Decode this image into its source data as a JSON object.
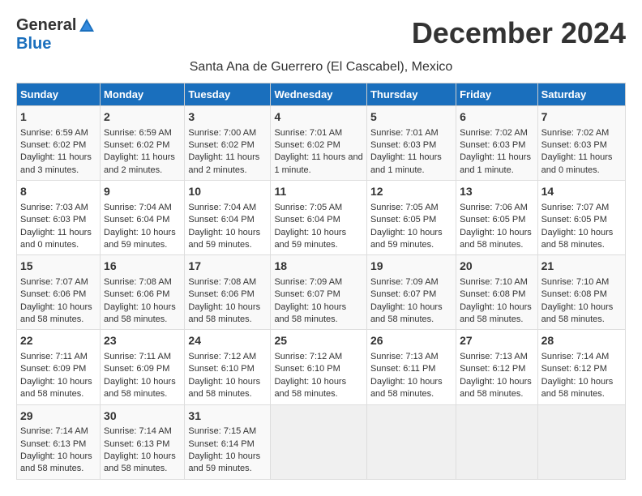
{
  "header": {
    "logo_general": "General",
    "logo_blue": "Blue",
    "month_title": "December 2024",
    "location": "Santa Ana de Guerrero (El Cascabel), Mexico"
  },
  "days_of_week": [
    "Sunday",
    "Monday",
    "Tuesday",
    "Wednesday",
    "Thursday",
    "Friday",
    "Saturday"
  ],
  "weeks": [
    [
      {
        "day": 1,
        "sunrise": "6:59 AM",
        "sunset": "6:02 PM",
        "daylight": "11 hours and 3 minutes."
      },
      {
        "day": 2,
        "sunrise": "6:59 AM",
        "sunset": "6:02 PM",
        "daylight": "11 hours and 2 minutes."
      },
      {
        "day": 3,
        "sunrise": "7:00 AM",
        "sunset": "6:02 PM",
        "daylight": "11 hours and 2 minutes."
      },
      {
        "day": 4,
        "sunrise": "7:01 AM",
        "sunset": "6:02 PM",
        "daylight": "11 hours and 1 minute."
      },
      {
        "day": 5,
        "sunrise": "7:01 AM",
        "sunset": "6:03 PM",
        "daylight": "11 hours and 1 minute."
      },
      {
        "day": 6,
        "sunrise": "7:02 AM",
        "sunset": "6:03 PM",
        "daylight": "11 hours and 1 minute."
      },
      {
        "day": 7,
        "sunrise": "7:02 AM",
        "sunset": "6:03 PM",
        "daylight": "11 hours and 0 minutes."
      }
    ],
    [
      {
        "day": 8,
        "sunrise": "7:03 AM",
        "sunset": "6:03 PM",
        "daylight": "11 hours and 0 minutes."
      },
      {
        "day": 9,
        "sunrise": "7:04 AM",
        "sunset": "6:04 PM",
        "daylight": "10 hours and 59 minutes."
      },
      {
        "day": 10,
        "sunrise": "7:04 AM",
        "sunset": "6:04 PM",
        "daylight": "10 hours and 59 minutes."
      },
      {
        "day": 11,
        "sunrise": "7:05 AM",
        "sunset": "6:04 PM",
        "daylight": "10 hours and 59 minutes."
      },
      {
        "day": 12,
        "sunrise": "7:05 AM",
        "sunset": "6:05 PM",
        "daylight": "10 hours and 59 minutes."
      },
      {
        "day": 13,
        "sunrise": "7:06 AM",
        "sunset": "6:05 PM",
        "daylight": "10 hours and 58 minutes."
      },
      {
        "day": 14,
        "sunrise": "7:07 AM",
        "sunset": "6:05 PM",
        "daylight": "10 hours and 58 minutes."
      }
    ],
    [
      {
        "day": 15,
        "sunrise": "7:07 AM",
        "sunset": "6:06 PM",
        "daylight": "10 hours and 58 minutes."
      },
      {
        "day": 16,
        "sunrise": "7:08 AM",
        "sunset": "6:06 PM",
        "daylight": "10 hours and 58 minutes."
      },
      {
        "day": 17,
        "sunrise": "7:08 AM",
        "sunset": "6:06 PM",
        "daylight": "10 hours and 58 minutes."
      },
      {
        "day": 18,
        "sunrise": "7:09 AM",
        "sunset": "6:07 PM",
        "daylight": "10 hours and 58 minutes."
      },
      {
        "day": 19,
        "sunrise": "7:09 AM",
        "sunset": "6:07 PM",
        "daylight": "10 hours and 58 minutes."
      },
      {
        "day": 20,
        "sunrise": "7:10 AM",
        "sunset": "6:08 PM",
        "daylight": "10 hours and 58 minutes."
      },
      {
        "day": 21,
        "sunrise": "7:10 AM",
        "sunset": "6:08 PM",
        "daylight": "10 hours and 58 minutes."
      }
    ],
    [
      {
        "day": 22,
        "sunrise": "7:11 AM",
        "sunset": "6:09 PM",
        "daylight": "10 hours and 58 minutes."
      },
      {
        "day": 23,
        "sunrise": "7:11 AM",
        "sunset": "6:09 PM",
        "daylight": "10 hours and 58 minutes."
      },
      {
        "day": 24,
        "sunrise": "7:12 AM",
        "sunset": "6:10 PM",
        "daylight": "10 hours and 58 minutes."
      },
      {
        "day": 25,
        "sunrise": "7:12 AM",
        "sunset": "6:10 PM",
        "daylight": "10 hours and 58 minutes."
      },
      {
        "day": 26,
        "sunrise": "7:13 AM",
        "sunset": "6:11 PM",
        "daylight": "10 hours and 58 minutes."
      },
      {
        "day": 27,
        "sunrise": "7:13 AM",
        "sunset": "6:12 PM",
        "daylight": "10 hours and 58 minutes."
      },
      {
        "day": 28,
        "sunrise": "7:14 AM",
        "sunset": "6:12 PM",
        "daylight": "10 hours and 58 minutes."
      }
    ],
    [
      {
        "day": 29,
        "sunrise": "7:14 AM",
        "sunset": "6:13 PM",
        "daylight": "10 hours and 58 minutes."
      },
      {
        "day": 30,
        "sunrise": "7:14 AM",
        "sunset": "6:13 PM",
        "daylight": "10 hours and 58 minutes."
      },
      {
        "day": 31,
        "sunrise": "7:15 AM",
        "sunset": "6:14 PM",
        "daylight": "10 hours and 59 minutes."
      },
      null,
      null,
      null,
      null
    ]
  ],
  "labels": {
    "sunrise": "Sunrise:",
    "sunset": "Sunset:",
    "daylight": "Daylight:"
  }
}
